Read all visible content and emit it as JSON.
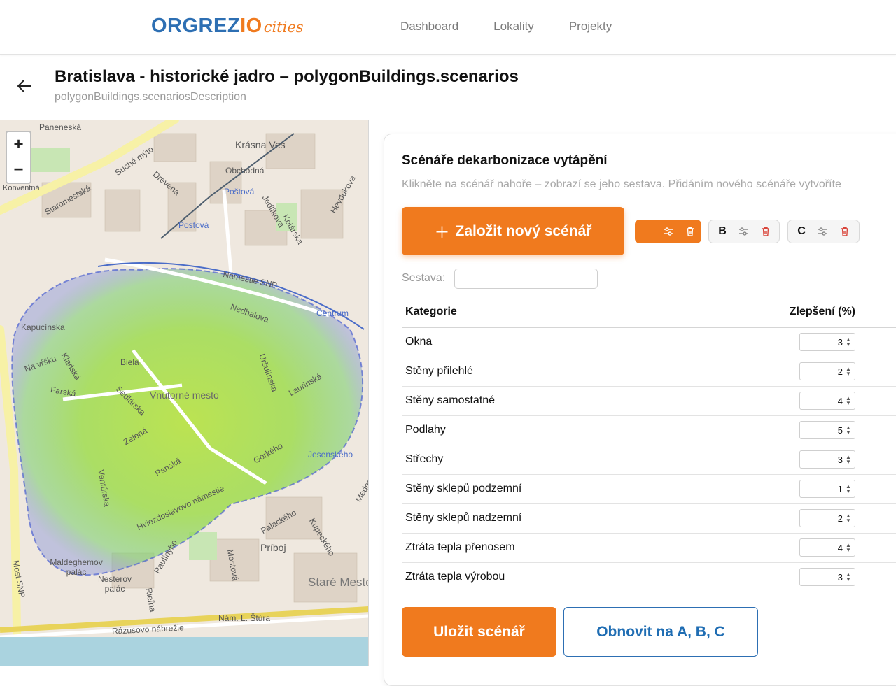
{
  "app": {
    "logo_main": "ORGREZ",
    "logo_io": "IO",
    "logo_cities": "cities",
    "nav": [
      "Dashboard",
      "Lokality",
      "Projekty"
    ]
  },
  "page": {
    "title": "Bratislava - historické jadro – polygonBuildings.scenarios",
    "subtitle": "polygonBuildings.scenariosDescription"
  },
  "map": {
    "zoom_in": "+",
    "zoom_out": "−",
    "labels": [
      "Paneneská",
      "Suché mýto",
      "Krásna Ves",
      "Obchodná",
      "Poštová",
      "Postová",
      "Drevená",
      "Staromestská",
      "Konventná",
      "Jedlíkova",
      "Kolárska",
      "Heydukova",
      "Námestie SNP",
      "Nedbalova",
      "Centrum",
      "Kapucínska",
      "Na vŕšku",
      "Klariská",
      "Farská",
      "Biela",
      "Sedlárska",
      "Vnútorné mesto",
      "Uršulínska",
      "Laurinská",
      "Zelená",
      "Panská",
      "Gorkého",
      "Jesenského",
      "Ventúrska",
      "Hviezdoslavovo námestie",
      "Palackého",
      "Príboj",
      "Mostová",
      "Paulínyho",
      "Maldeghemov palác",
      "Nesterov palác",
      "Rázusovo nábrežie",
      "Most SNP",
      "Staré Mesto",
      "Rieľna",
      "Nám. Ľ. Štúra",
      "Medená",
      "Kupeckého"
    ]
  },
  "panel": {
    "title": "Scénáře dekarbonizace vytápění",
    "hint": "Klikněte na scénář nahoře – zobrazí se jeho sestava. Přidáním nového scénáře vytvoříte",
    "new_button": "Založit nový scénář",
    "new_button_icon": "plus-icon",
    "scenarios": [
      {
        "label": "",
        "active": true
      },
      {
        "label": "B",
        "active": false
      },
      {
        "label": "C",
        "active": false
      }
    ],
    "sestava_label": "Sestava:",
    "sestava_value": "",
    "table": {
      "col_category": "Kategorie",
      "col_improvement": "Zlepšení (%)",
      "rows": [
        {
          "name": "Okna",
          "value": "3"
        },
        {
          "name": "Stěny přilehlé",
          "value": "2"
        },
        {
          "name": "Stěny samostatné",
          "value": "4"
        },
        {
          "name": "Podlahy",
          "value": "5"
        },
        {
          "name": "Střechy",
          "value": "3"
        },
        {
          "name": "Stěny sklepů podzemní",
          "value": "1"
        },
        {
          "name": "Stěny sklepů nadzemní",
          "value": "2"
        },
        {
          "name": "Ztráta tepla přenosem",
          "value": "4"
        },
        {
          "name": "Ztráta tepla výrobou",
          "value": "3"
        }
      ]
    },
    "save_button": "Uložit scénář",
    "reset_button": "Obnovit na A, B, C"
  },
  "colors": {
    "accent": "#f07a1e",
    "brand_blue": "#2d6fb3",
    "delete_red": "#d9453b"
  }
}
